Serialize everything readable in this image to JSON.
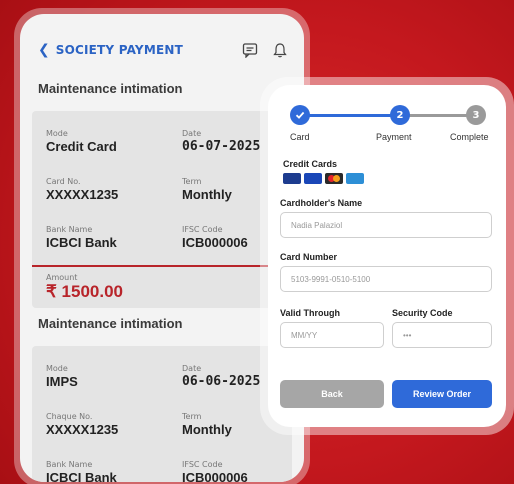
{
  "app": {
    "header": {
      "title": "SOCIETY PAYMENT"
    },
    "sections": [
      {
        "title": "Maintenance intimation",
        "fields": [
          {
            "label": "Mode",
            "value": "Credit Card"
          },
          {
            "label": "Date",
            "value": "06-07-2025"
          },
          {
            "label": "Card No.",
            "value": "XXXXX1235"
          },
          {
            "label": "Term",
            "value": "Monthly"
          },
          {
            "label": "Bank Name",
            "value": "ICBCI Bank"
          },
          {
            "label": "IFSC Code",
            "value": "ICB000006"
          }
        ],
        "amount": {
          "label": "Amount",
          "value": "₹ 1500.00"
        }
      },
      {
        "title": "Maintenance intimation",
        "fields": [
          {
            "label": "Mode",
            "value": "IMPS"
          },
          {
            "label": "Date",
            "value": "06-06-2025"
          },
          {
            "label": "Chaque No.",
            "value": "XXXXX1235"
          },
          {
            "label": "Term",
            "value": "Monthly"
          },
          {
            "label": "Bank Name",
            "value": "ICBCI Bank"
          },
          {
            "label": "IFSC Code",
            "value": "ICB000006"
          }
        ]
      }
    ]
  },
  "payment": {
    "steps": [
      {
        "label": "Card",
        "number": "",
        "state": "done"
      },
      {
        "label": "Payment",
        "number": "2",
        "state": "active"
      },
      {
        "label": "Complete",
        "number": "3",
        "state": "pending"
      }
    ],
    "credit_cards_label": "Credit Cards",
    "card_brands": [
      "paypal-icon",
      "visa-icon",
      "mastercard-icon",
      "amex-icon"
    ],
    "cardholder": {
      "label": "Cardholder's Name",
      "placeholder": "Nadia Palaziol"
    },
    "card_number": {
      "label": "Card Number",
      "placeholder": "5103-9991-0510-5100"
    },
    "valid_through": {
      "label": "Valid Through",
      "placeholder": "MM/YY"
    },
    "security_code": {
      "label": "Security Code",
      "placeholder": "•••"
    },
    "buttons": {
      "back": "Back",
      "review": "Review Order"
    }
  },
  "colors": {
    "accent_blue": "#2b63c4",
    "brand_red": "#c4181e",
    "amount_red": "#b8242a",
    "step_pending": "#9a9a9a",
    "back_button": "#a6a6a6",
    "review_button": "#2f6ad9"
  }
}
